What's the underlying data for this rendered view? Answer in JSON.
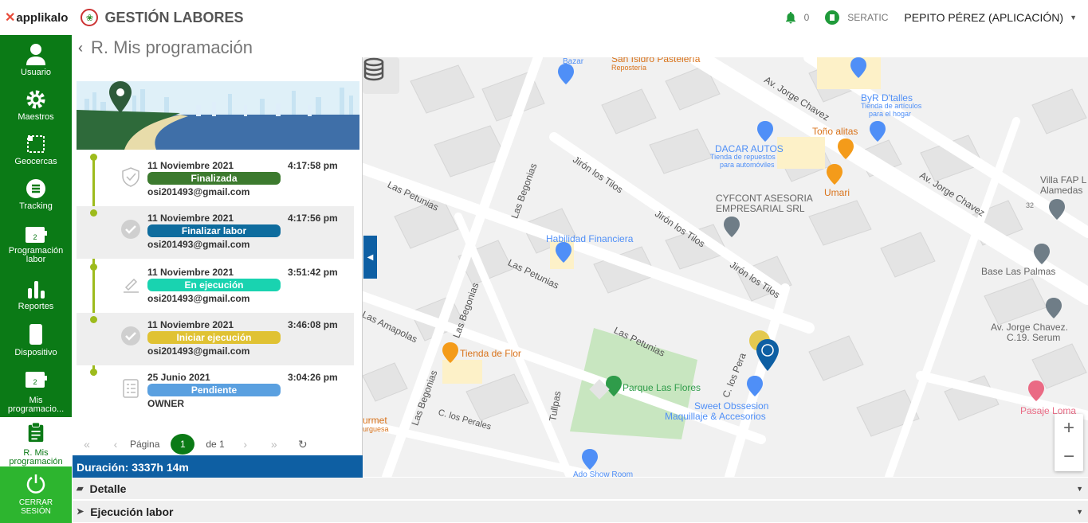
{
  "header": {
    "brand": "applikalo",
    "app_title": "GESTIÓN LABORES",
    "notifications": "0",
    "company": "SERATIC",
    "user": "PEPITO PÉREZ (APLICACIÓN)"
  },
  "sidebar": {
    "items": [
      {
        "label": "Usuario"
      },
      {
        "label": "Maestros"
      },
      {
        "label": "Geocercas"
      },
      {
        "label": "Tracking"
      },
      {
        "label": "Programación labor"
      },
      {
        "label": "Reportes"
      },
      {
        "label": "Dispositivo"
      },
      {
        "label": "Mis programacio..."
      },
      {
        "label": "R. Mis programación"
      },
      {
        "label": "CERRAR SESIÓN"
      }
    ]
  },
  "page": {
    "title": "R. Mis programación"
  },
  "timeline": [
    {
      "date": "11 Noviembre 2021",
      "time": "4:17:58 pm",
      "status": "Finalizada",
      "color": "#3c7a2e",
      "detail": "osi201493@gmail.com",
      "icon": "shield-check-icon"
    },
    {
      "date": "11 Noviembre 2021",
      "time": "4:17:56 pm",
      "status": "Finalizar labor",
      "color": "#0e6c9e",
      "detail": "osi201493@gmail.com",
      "icon": "check-circle-icon"
    },
    {
      "date": "11 Noviembre 2021",
      "time": "3:51:42 pm",
      "status": "En ejecución",
      "color": "#19d3b0",
      "detail": "osi201493@gmail.com",
      "icon": "pencil-icon"
    },
    {
      "date": "11 Noviembre 2021",
      "time": "3:46:08 pm",
      "status": "Iniciar ejecución",
      "color": "#e0c233",
      "detail": "osi201493@gmail.com",
      "icon": "check-circle-icon"
    },
    {
      "date": "25 Junio 2021",
      "time": "3:04:26 pm",
      "status": "Pendiente",
      "color": "#5aa0e0",
      "detail": "OWNER",
      "icon": "checklist-icon"
    }
  ],
  "pager": {
    "page_label": "Página",
    "current": "1",
    "of_label": "de 1"
  },
  "duration": "Duración: 3337h 14m",
  "map": {
    "labels": [
      "Bazar",
      "San Isidro Pastelería",
      "Repostería",
      "Av. Jorge Chavez",
      "ByR D'talles",
      "Tienda de artículos",
      "para el hogar",
      "Toño alitas",
      "DACAR AUTOS",
      "Tienda de repuestos",
      "para automóviles",
      "Umari",
      "CYFCONT ASESORIA",
      "EMPRESARIAL SRL",
      "Villa FAP L",
      "Alamedas",
      "Habilidad Financiera",
      "Base Las Palmas",
      "Av. Jorge Chavez.",
      "C.19. Serum",
      "Tienda de Flor",
      "Parque Las Flores",
      "Sweet Obssesion",
      "Maquillaje & Accesorios",
      "Pasaje Loma",
      "Ado Show Room",
      "urmet",
      "urguesa",
      "32"
    ],
    "streets": [
      "Las Petunias",
      "Las Begonias",
      "Jirón los Tilos",
      "Jirón los Tilos",
      "Jirón los Tilos",
      "Las Petunias",
      "Las Begonias",
      "Las Petunias",
      "Las Amapolas",
      "Las Begonias",
      "C. los Perales",
      "Tullpas",
      "C. los Pera",
      "Av. Jorge Chavez"
    ]
  },
  "sections": [
    {
      "label": "Detalle"
    },
    {
      "label": "Ejecución labor"
    }
  ]
}
